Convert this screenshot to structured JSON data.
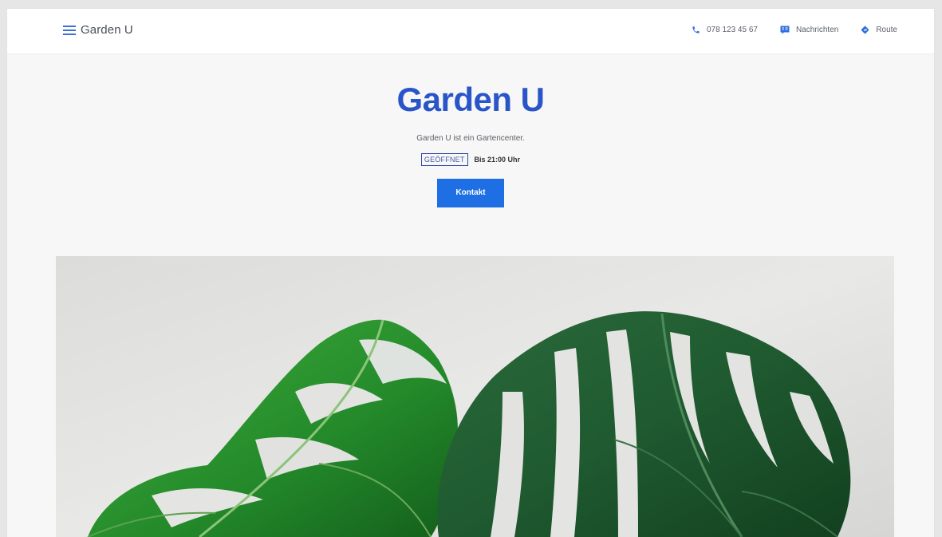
{
  "header": {
    "brand": "Garden U",
    "actions": [
      {
        "label": "078 123 45 67",
        "icon": "phone-icon"
      },
      {
        "label": "Nachrichten",
        "icon": "message-icon"
      },
      {
        "label": "Route",
        "icon": "directions-icon"
      }
    ]
  },
  "hero": {
    "title": "Garden U",
    "subtitle": "Garden U ist ein Gartencenter.",
    "status": "GEÖFFNET",
    "hours": "Bis 21:00 Uhr",
    "cta": "Kontakt"
  },
  "image": {
    "subject": "monstera-leaves-photo"
  },
  "colors": {
    "accent": "#1e6fe3",
    "title": "#2a55c9",
    "badge_border": "#2e48a6"
  }
}
